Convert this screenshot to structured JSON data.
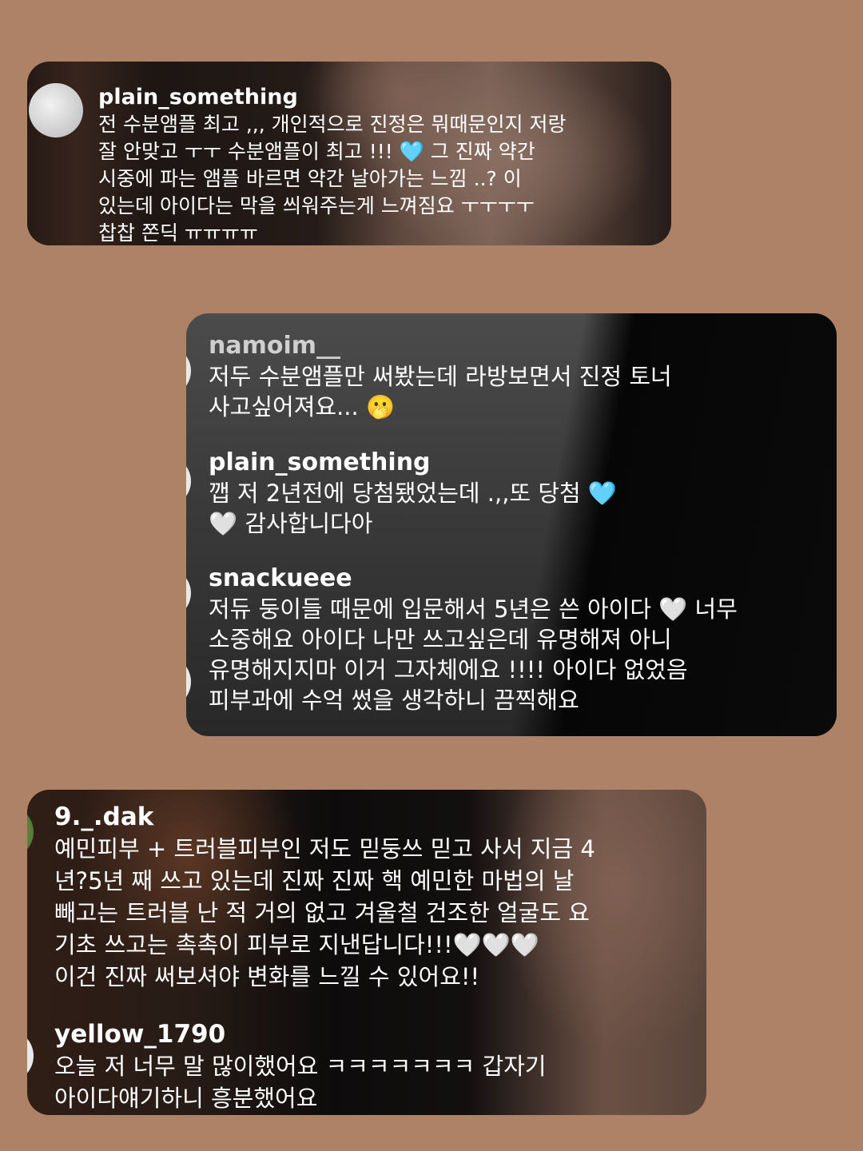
{
  "comments": [
    {
      "username": "plain_something",
      "text": "전 수분앰플 최고 ,,, 개인적으로 진정은 뭐때문인지 저랑\n잘 안맞고 ㅜㅜ 수분앰플이 최고 !!! 🩵 그 진짜 약간\n시중에 파는 앰플 바르면 약간 날아가는 느낌 ..? 이\n있는데 아이다는 막을 씌워주는게 느껴짐요 ㅜㅜㅜㅜ\n찹찹 쫀딕 ㅠㅠㅠㅠ"
    },
    {
      "username": "namoim__",
      "text": "저두 수분앰플만 써봤는데 라방보면서 진정 토너\n사고싶어져요... 🫢"
    },
    {
      "username": "plain_something",
      "text": "깹 저 2년전에 당첨됐었는데 .,,또 당첨 🩵\n🤍 감사합니다아"
    },
    {
      "username": "snackueee",
      "text": "저듀 둥이들 때문에 입문해서 5년은 쓴 아이다 🤍 너무\n소중해요 아이다 나만 쓰고싶은데 유명해져 아니\n유명해지지마 이거 그자체에요 !!!! 아이다 없었음\n피부과에 수억 썼을 생각하니 끔찍해요"
    },
    {
      "username": "9._.dak",
      "text": "예민피부 + 트러블피부인 저도 믿둥쓰 믿고 사서 지금 4\n년?5년 째 쓰고 있는데 진짜 진짜 핵 예민한 마법의 날\n빼고는 트러블 난 적 거의 없고 겨울철 건조한 얼굴도 요\n기초 쓰고는 촉촉이 피부로 지낸답니다!!!🤍🤍🤍\n이건 진짜 써보셔야 변화를 느낄 수 있어요!!"
    },
    {
      "username": "yellow_1790",
      "text": "오늘 저 너무 말 많이했어요 ㅋㅋㅋㅋㅋㅋㅋ 갑자기\n아이다얘기하니 흥분했어요"
    }
  ]
}
